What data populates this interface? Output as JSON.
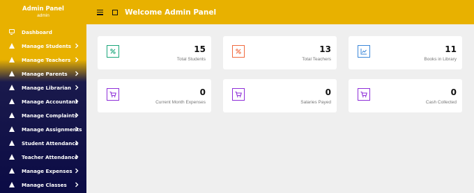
{
  "brand": {
    "name": "Admin Panel",
    "user": "admin"
  },
  "header": {
    "title": "Welcome Admin Panel"
  },
  "menu": [
    {
      "label": "Dashboard",
      "icon": "monitor-icon",
      "chevron": false
    },
    {
      "label": "Manage Students",
      "icon": "triangle-icon",
      "chevron": true
    },
    {
      "label": "Manage Teachers",
      "icon": "triangle-icon",
      "chevron": true
    },
    {
      "label": "Manage Parents",
      "icon": "triangle-icon",
      "chevron": true
    },
    {
      "label": "Manage Librarian",
      "icon": "triangle-icon",
      "chevron": true
    },
    {
      "label": "Manage Accountant",
      "icon": "triangle-icon",
      "chevron": true
    },
    {
      "label": "Manage Complaints",
      "icon": "triangle-icon",
      "chevron": true
    },
    {
      "label": "Manage Assignments",
      "icon": "triangle-icon",
      "chevron": true
    },
    {
      "label": "Student Attendance",
      "icon": "triangle-icon",
      "chevron": true
    },
    {
      "label": "Teacher Attendance",
      "icon": "triangle-icon",
      "chevron": true
    },
    {
      "label": "Manage Expenses",
      "icon": "triangle-icon",
      "chevron": true
    },
    {
      "label": "Manage Classes",
      "icon": "triangle-icon",
      "chevron": true
    }
  ],
  "cards": [
    {
      "value": "15",
      "label": "Total Students",
      "icon": "percent-icon",
      "color": "#1aa67a"
    },
    {
      "value": "13",
      "label": "Total Teachers",
      "icon": "percent-icon",
      "color": "#f0693e"
    },
    {
      "value": "11",
      "label": "Books in Library",
      "icon": "line-chart-icon",
      "color": "#3b87d9"
    },
    {
      "value": "0",
      "label": "Current Month Expenses",
      "icon": "cart-icon",
      "color": "#8e2dd8"
    },
    {
      "value": "0",
      "label": "Salaries Payed",
      "icon": "cart-icon",
      "color": "#8e2dd8"
    },
    {
      "value": "0",
      "label": "Cash Collected",
      "icon": "cart-icon",
      "color": "#8e2dd8"
    }
  ],
  "colors": {
    "accent": "#e8b100",
    "sidebar_dark": "#0b0b45",
    "background": "#efefef"
  }
}
